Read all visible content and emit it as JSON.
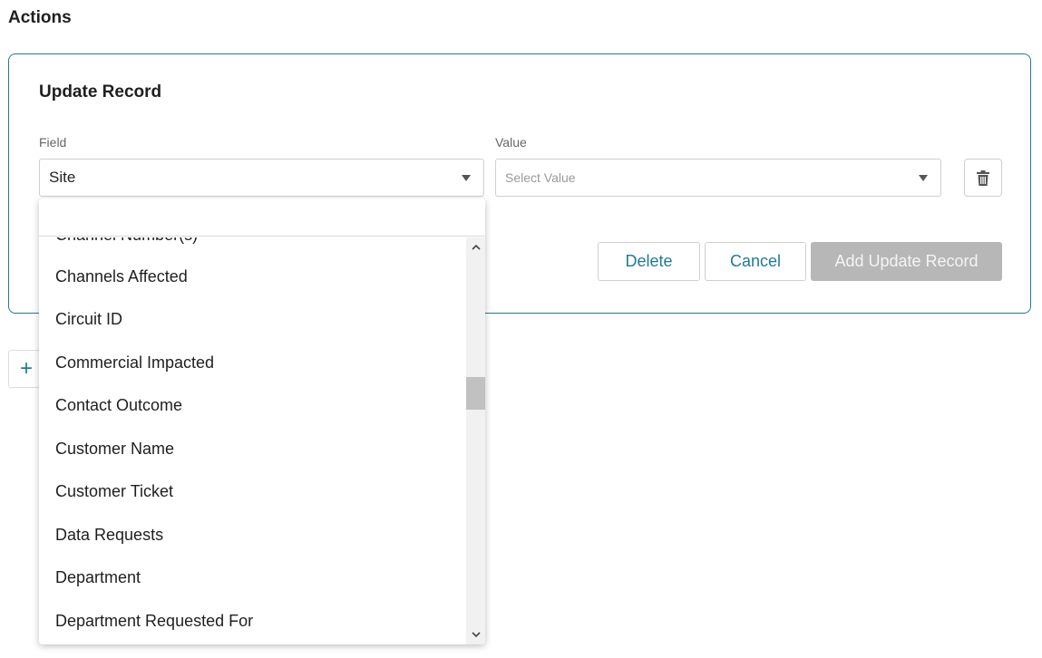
{
  "header": {
    "title": "Actions"
  },
  "card": {
    "title": "Update Record",
    "field": {
      "label": "Field",
      "value": "Site"
    },
    "value": {
      "label": "Value",
      "placeholder": "Select Value"
    },
    "buttons": {
      "delete": "Delete",
      "cancel": "Cancel",
      "add": "Add Update Record"
    }
  },
  "add_action": {
    "symbol": "+"
  },
  "dropdown": {
    "search_value": "",
    "partial_item": "Channel Number(s)",
    "items": [
      "Channels Affected",
      "Circuit ID",
      "Commercial Impacted",
      "Contact Outcome",
      "Customer Name",
      "Customer Ticket",
      "Data Requests",
      "Department",
      "Department Requested For"
    ]
  },
  "icons": {
    "caret": "caret-down-icon",
    "trash": "trash-icon",
    "plus": "plus-icon",
    "scroll_up": "chevron-up-icon",
    "scroll_down": "chevron-down-icon"
  },
  "colors": {
    "accent": "#1f7a99",
    "disabled_button": "#b7b7b7",
    "border": "#cfcfcf"
  }
}
